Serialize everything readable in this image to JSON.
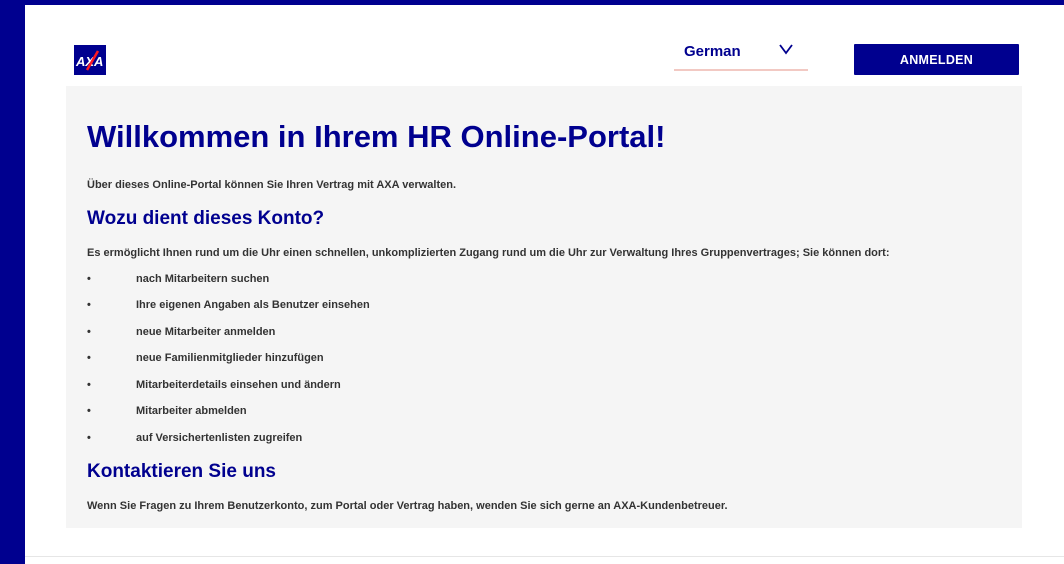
{
  "header": {
    "logo_text": "AXA",
    "language": {
      "label": "German"
    },
    "login_label": "ANMELDEN"
  },
  "main": {
    "title": "Willkommen in Ihrem HR Online-Portal!",
    "intro": "Über dieses Online-Portal können Sie Ihren Vertrag mit AXA verwalten.",
    "purpose": {
      "heading": "Wozu dient dieses Konto?",
      "text": "Es ermöglicht Ihnen rund um die Uhr einen schnellen, unkomplizierten Zugang rund um die Uhr zur Verwaltung Ihres Gruppenvertrages; Sie können dort:",
      "bullet": "•",
      "items": [
        "nach Mitarbeitern suchen",
        "Ihre eigenen Angaben als Benutzer einsehen",
        "neue Mitarbeiter anmelden",
        "neue Familienmitglieder hinzufügen",
        "Mitarbeiterdetails einsehen und ändern",
        "Mitarbeiter abmelden",
        "auf Versichertenlisten zugreifen"
      ]
    },
    "contact": {
      "heading": "Kontaktieren Sie uns",
      "text": "Wenn Sie Fragen zu Ihrem Benutzerkonto, zum Portal oder Vertrag haben, wenden Sie sich gerne an AXA-Kundenbetreuer."
    }
  },
  "colors": {
    "brand_blue": "#00008f",
    "accent_red": "#ff1721",
    "panel_bg": "#f5f5f5",
    "body_text": "#333333"
  },
  "icons": {
    "logo": "axa-logo",
    "dropdown": "chevron-down-icon"
  }
}
